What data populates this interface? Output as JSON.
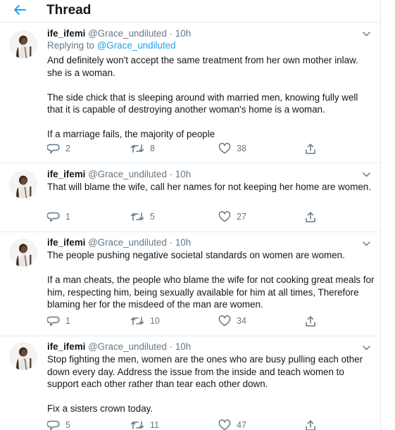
{
  "header": {
    "title": "Thread",
    "back_icon": "arrow-left-icon",
    "accent": "#1da1f2"
  },
  "tweets": [
    {
      "name": "ife_ifemi",
      "handle": "@Grace_undiluted",
      "separator": "·",
      "time": "10h",
      "replying_prefix": "Replying to ",
      "replying_to": "@Grace_undiluted",
      "paragraphs": [
        "And definitely won't accept the same treatment from her own mother inlaw. she is a woman.",
        "The side chick that is sleeping around with married men, knowing fully well that it is capable of destroying another woman's home is a woman.",
        "If a marriage fails, the majority of people"
      ],
      "replies": "2",
      "retweets": "8",
      "likes": "38"
    },
    {
      "name": "ife_ifemi",
      "handle": "@Grace_undiluted",
      "separator": "·",
      "time": "10h",
      "paragraphs": [
        "That will blame the wife, call her names for not keeping her home are women."
      ],
      "replies": "1",
      "retweets": "5",
      "likes": "27"
    },
    {
      "name": "ife_ifemi",
      "handle": "@Grace_undiluted",
      "separator": "·",
      "time": "10h",
      "paragraphs": [
        "The people pushing negative societal standards on women are women.",
        "If a man cheats, the people who blame the wife for not cooking great meals for him, respecting him, being sexually available for him at all times, Therefore blaming her for the misdeed of the man are women."
      ],
      "replies": "1",
      "retweets": "10",
      "likes": "34"
    },
    {
      "name": "ife_ifemi",
      "handle": "@Grace_undiluted",
      "separator": "·",
      "time": "10h",
      "paragraphs": [
        "Stop fighting the men, women are the ones  who are busy pulling each other down every day. Address the issue from the inside and teach women to support each other rather than tear each other down.",
        "Fix a sisters crown today."
      ],
      "replies": "5",
      "retweets": "11",
      "likes": "47"
    }
  ]
}
